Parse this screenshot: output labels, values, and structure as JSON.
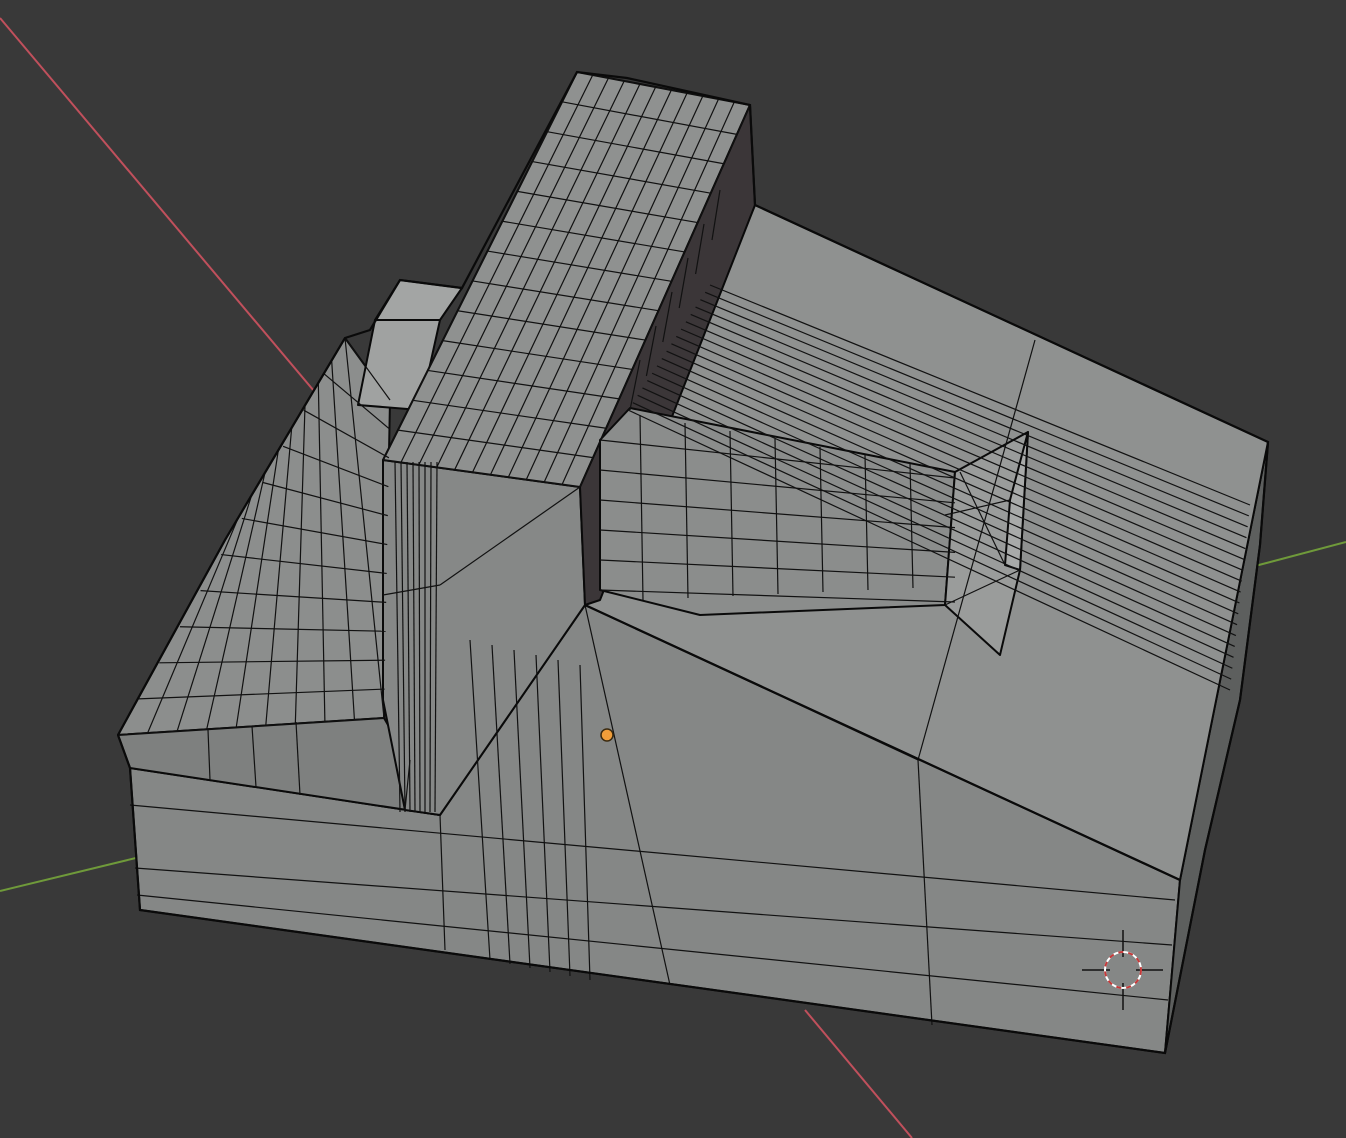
{
  "viewport": {
    "background": "#393939",
    "mode": "Solid",
    "show_wireframe": true
  },
  "axes": {
    "x_axis": {
      "color": "#c0505c",
      "visible": true
    },
    "y_axis": {
      "color": "#6f9a3a",
      "visible": true
    }
  },
  "object": {
    "type": "mesh",
    "material_color": "#8d8f8e",
    "origin_color": "#f19e3a"
  },
  "cursor_3d": {
    "icon": "3d-cursor-icon",
    "ring_colors": [
      "#c53a3a",
      "#ffffff"
    ]
  }
}
